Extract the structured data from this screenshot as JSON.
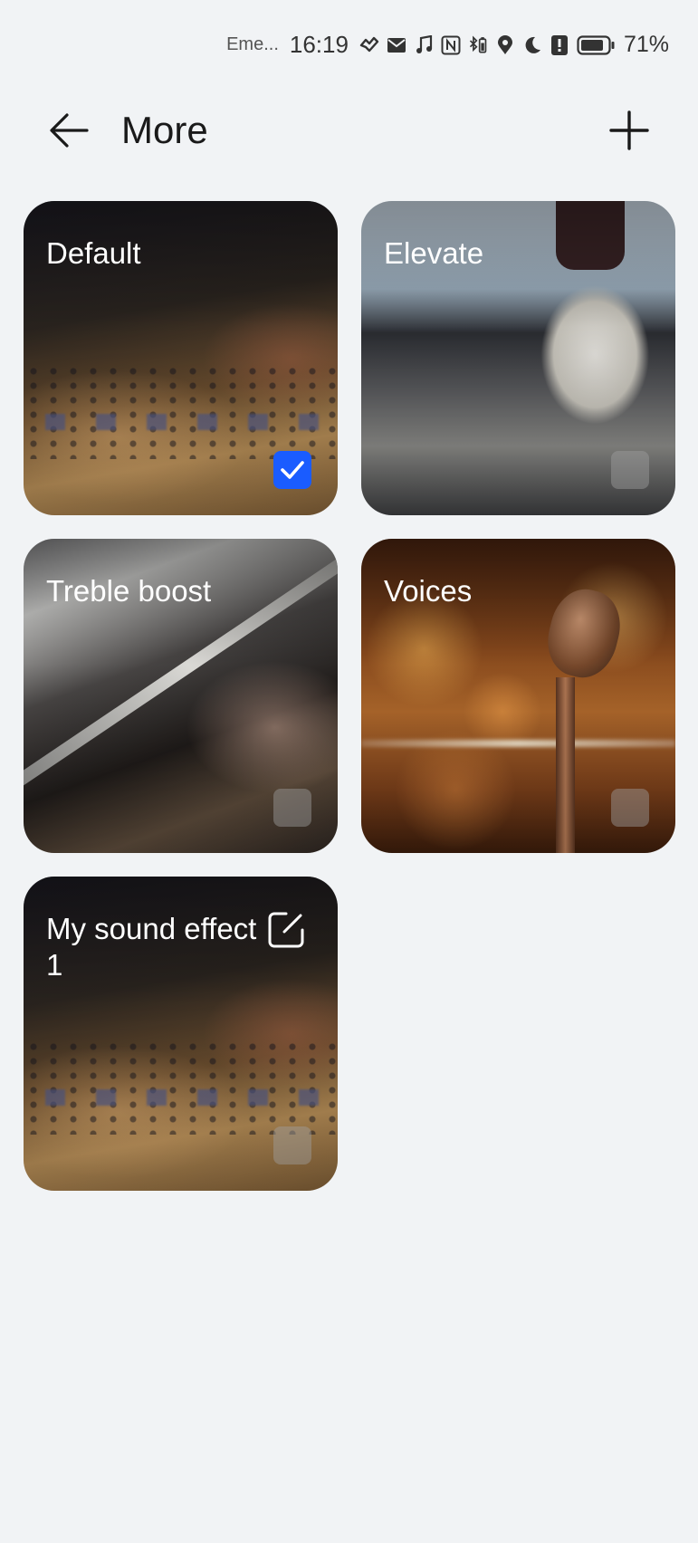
{
  "status_bar": {
    "carrier": "Eme...",
    "time": "16:19",
    "battery_percent": "71%",
    "icons": [
      "link-icon",
      "mail-icon",
      "music-note-icon",
      "nfc-icon",
      "bluetooth-battery-icon",
      "location-icon",
      "moon-icon",
      "alert-icon",
      "battery-icon"
    ]
  },
  "header": {
    "title": "More",
    "back_icon": "arrow-left-icon",
    "add_icon": "plus-icon"
  },
  "effects": [
    {
      "title": "Default",
      "selected": true
    },
    {
      "title": "Elevate",
      "selected": false
    },
    {
      "title": "Treble boost",
      "selected": false
    },
    {
      "title": "Voices",
      "selected": false
    },
    {
      "title": "My sound effect 1",
      "selected": false,
      "editable": true
    }
  ],
  "colors": {
    "background": "#f1f3f5",
    "accent": "#1a5cff",
    "text": "#1a1a1a"
  }
}
